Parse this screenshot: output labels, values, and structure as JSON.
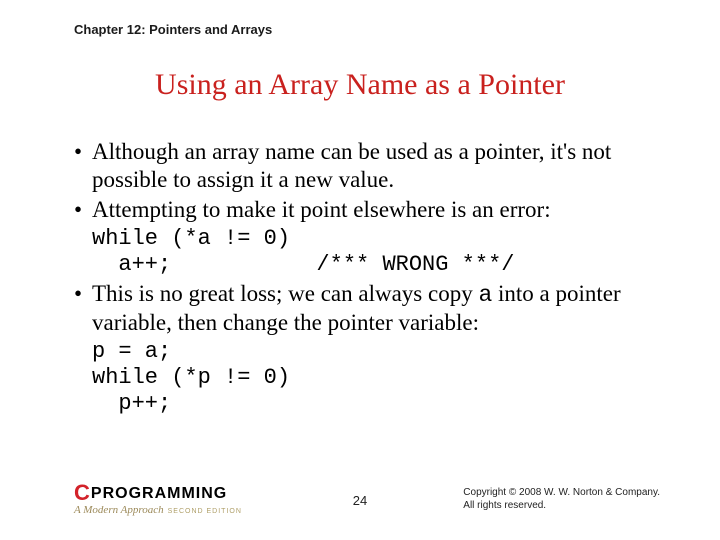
{
  "chapter": "Chapter 12: Pointers and Arrays",
  "title": "Using an Array Name as a Pointer",
  "bullets": {
    "b1": "Although an array name can be used as a pointer, it's not possible to assign it a new value.",
    "b2": "Attempting to make it point elsewhere is an error:",
    "b3_pre": "This is no great loss; we can always copy ",
    "b3_code": "a",
    "b3_post": " into a pointer variable, then change the pointer variable:"
  },
  "code1": "while (*a != 0)\n  a++;           /*** WRONG ***/",
  "code2": "p = a;\nwhile (*p != 0)\n  p++;",
  "footer": {
    "logo_c": "C",
    "logo_rest": "PROGRAMMING",
    "logo_sub": "A Modern Approach",
    "logo_edition": "SECOND EDITION",
    "page": "24",
    "copyright_l1": "Copyright © 2008 W. W. Norton & Company.",
    "copyright_l2": "All rights reserved."
  }
}
